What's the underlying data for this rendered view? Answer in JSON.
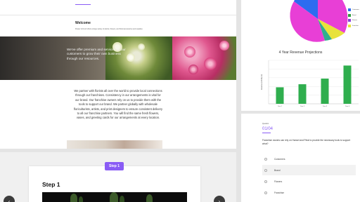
{
  "welcome": {
    "title": "Welcome",
    "subtitle": "Flower & Fresh offers a large variety of plants, flowers, and floral accessories and supplies."
  },
  "hero": {
    "text": "We've offer premium and services for our customers to grow their own business through our resources."
  },
  "body_copy": "We partner with florists all over the world to provide local connections through our franchises. Consistency in our arrangements is vital for our brand. Our franchise owners rely on us to provide them with the tools to support our brand. We partner globally with wholesale floriculturists, artists, and print designers to ensure consistent delivery to all our franchise partners. You will find the same fresh flowers, vases, and greeting cards for our arrangements at every location.",
  "pie_legend": {
    "items": [
      {
        "label": "Customers",
        "color": "#2d6cf0"
      },
      {
        "label": "Brand",
        "color": "#2f9e3e"
      },
      {
        "label": "Flowers",
        "color": "#8a3bd8"
      },
      {
        "label": "Franchise",
        "color": "#e8e23a"
      }
    ],
    "pie_visible_colors": [
      "#2d6cf0",
      "#e83fd6",
      "#e8e23a",
      "#2fae8e"
    ]
  },
  "chart_data": {
    "type": "bar",
    "title": "4 Year Revenue Projections",
    "ylabel": "Revenue (USD$) (M)",
    "categories": [
      "Year 1",
      "Year 2",
      "Year 3",
      "Year 4"
    ],
    "values": [
      38,
      45,
      58,
      88
    ],
    "ylim": [
      0,
      100
    ],
    "bar_color": "#2fae4e",
    "grid": true
  },
  "quiz": {
    "label": "Question",
    "count": "01/04",
    "question": "Franchise owners can rely on Hansel and Petal to provide the necessary tools to support what?",
    "options": [
      {
        "label": "Customers",
        "active": false
      },
      {
        "label": "Brand",
        "active": true
      },
      {
        "label": "Flowers",
        "active": false
      },
      {
        "label": "Franchise",
        "active": false
      }
    ]
  },
  "step": {
    "badge": "Step 1",
    "title": "Step 1",
    "prev_icon": "chevron-left-icon",
    "next_icon": "chevron-right-icon",
    "prev_glyph": "‹",
    "next_glyph": "›"
  },
  "colors": {
    "accent": "#8a5cf5"
  }
}
